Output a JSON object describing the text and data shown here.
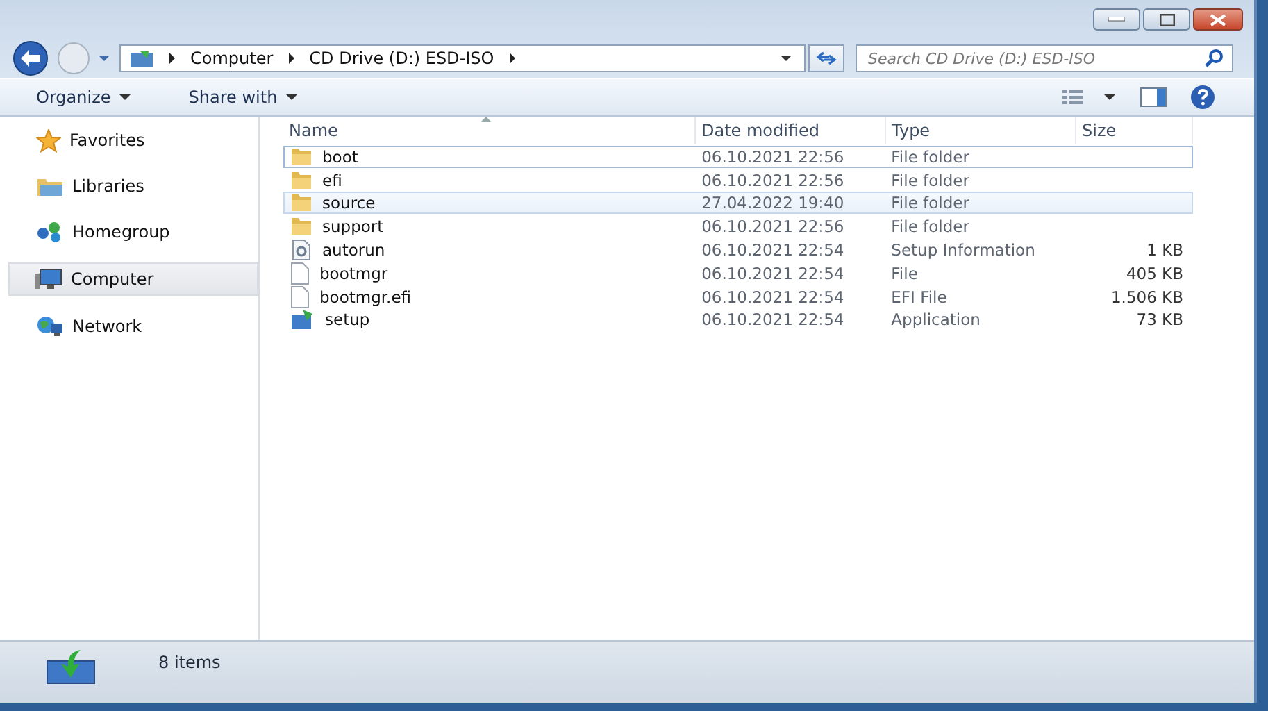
{
  "address_bar": {
    "crumbs": [
      "Computer",
      "CD Drive (D:) ESD-ISO"
    ]
  },
  "search": {
    "placeholder": "Search CD Drive (D:) ESD-ISO"
  },
  "toolbar": {
    "buttons": [
      "Organize",
      "Share with"
    ]
  },
  "sidebar": {
    "items": [
      {
        "label": "Favorites",
        "kind": "star",
        "selected": false
      },
      {
        "label": "Libraries",
        "kind": "library",
        "selected": false
      },
      {
        "label": "Homegroup",
        "kind": "homegroup",
        "selected": false
      },
      {
        "label": "Computer",
        "kind": "computer",
        "selected": true
      },
      {
        "label": "Network",
        "kind": "network",
        "selected": false
      }
    ]
  },
  "table": {
    "columns": [
      "Name",
      "Date modified",
      "Type",
      "Size"
    ],
    "rows": [
      {
        "name": "boot",
        "date": "06.10.2021 22:56",
        "type": "File folder",
        "kind": "folder",
        "focused": true,
        "hovered": false
      },
      {
        "name": "efi",
        "date": "06.10.2021 22:56",
        "type": "File folder",
        "kind": "folder",
        "focused": false,
        "hovered": false
      },
      {
        "name": "source",
        "date": "27.04.2022 19:40",
        "type": "File folder",
        "kind": "folder",
        "focused": false,
        "hovered": true
      },
      {
        "name": "support",
        "date": "06.10.2021 22:56",
        "type": "File folder",
        "kind": "folder",
        "focused": false,
        "hovered": false
      },
      {
        "name": "autorun",
        "date": "06.10.2021 22:54",
        "type": "Setup Information",
        "size": "1 KB",
        "kind": "setup",
        "focused": false,
        "hovered": false
      },
      {
        "name": "bootmgr",
        "date": "06.10.2021 22:54",
        "type": "File",
        "size": "405 KB",
        "kind": "file",
        "focused": false,
        "hovered": false
      },
      {
        "name": "bootmgr.efi",
        "date": "06.10.2021 22:54",
        "type": "EFI File",
        "size": "1.506 KB",
        "kind": "file",
        "focused": false,
        "hovered": false
      },
      {
        "name": "setup",
        "date": "06.10.2021 22:54",
        "type": "Application",
        "size": "73 KB",
        "kind": "app",
        "focused": false,
        "hovered": false
      }
    ]
  },
  "status_bar": {
    "count": "8 items"
  }
}
